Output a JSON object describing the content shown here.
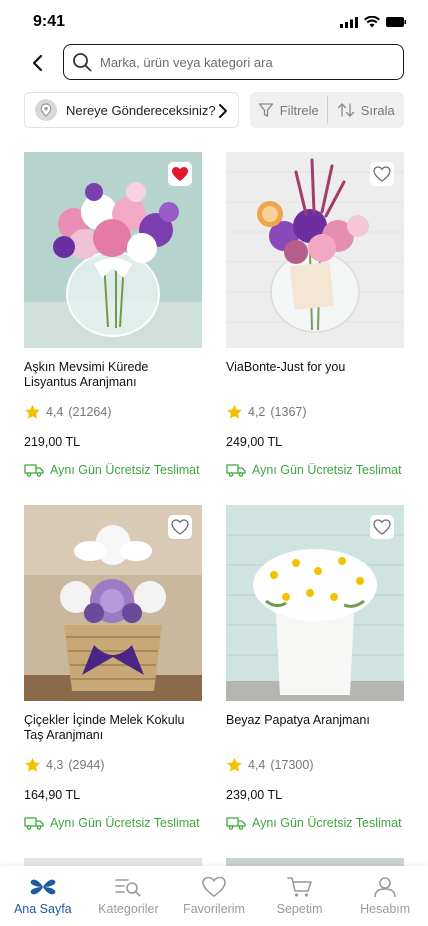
{
  "status": {
    "time": "9:41"
  },
  "search": {
    "placeholder": "Marka, ürün veya kategori ara"
  },
  "delivery": {
    "label": "Nereye Göndereceksiniz?"
  },
  "filters": {
    "filter_label": "Filtrele",
    "sort_label": "Sırala"
  },
  "products": [
    {
      "name": "Aşkın Mevsimi Kürede Lisyantus Aranjmanı",
      "rating": "4,4",
      "reviews": "(21264)",
      "price": "219,00 TL",
      "shipping": "Aynı Gün Ücretsiz Teslimat",
      "favorite": true
    },
    {
      "name": "ViaBonte-Just for you",
      "rating": "4,2",
      "reviews": "(1367)",
      "price": "249,00 TL",
      "shipping": "Aynı Gün Ücretsiz Teslimat",
      "favorite": false
    },
    {
      "name": "Çiçekler İçinde Melek Kokulu Taş Aranjmanı",
      "rating": "4,3",
      "reviews": "(2944)",
      "price": "164,90 TL",
      "shipping": "Aynı Gün Ücretsiz Teslimat",
      "favorite": false
    },
    {
      "name": "Beyaz Papatya Aranjmanı",
      "rating": "4,4",
      "reviews": "(17300)",
      "price": "239,00 TL",
      "shipping": "Aynı Gün Ücretsiz Teslimat",
      "favorite": false
    }
  ],
  "nav": [
    {
      "label": "Ana Sayfa",
      "icon": "home-flower-icon",
      "active": true
    },
    {
      "label": "Kategoriler",
      "icon": "categories-icon",
      "active": false
    },
    {
      "label": "Favorilerim",
      "icon": "heart-icon",
      "active": false
    },
    {
      "label": "Sepetim",
      "icon": "cart-icon",
      "active": false
    },
    {
      "label": "Hesabım",
      "icon": "user-icon",
      "active": false
    }
  ],
  "colors": {
    "accent": "#1f5aa6",
    "shipping": "#3fa63f",
    "favorite": "#e3182d",
    "star": "#f2c200"
  }
}
